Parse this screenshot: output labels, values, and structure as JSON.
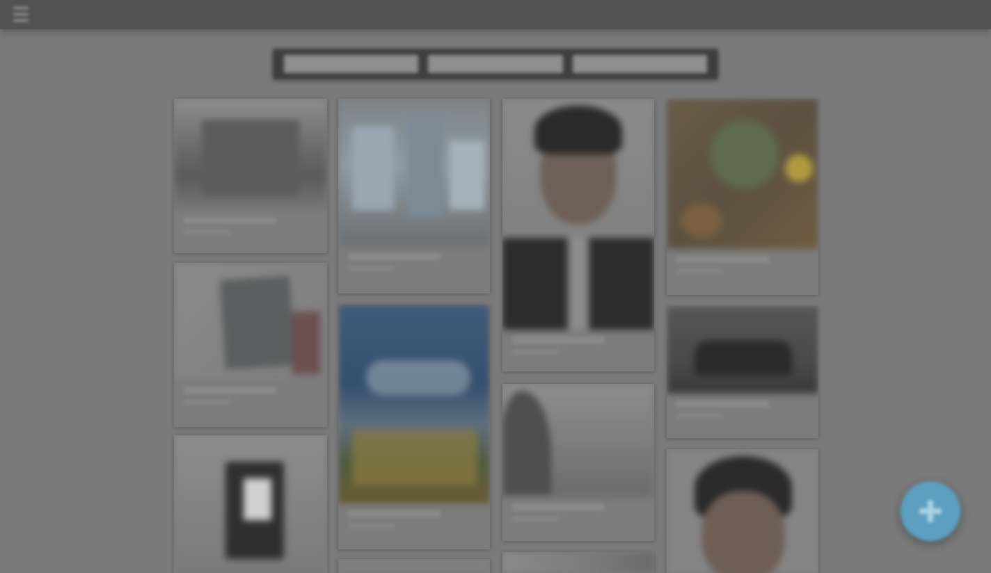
{
  "header": {
    "menu_icon": "hamburger-menu-icon"
  },
  "tabs": [
    {
      "label": ""
    },
    {
      "label": ""
    },
    {
      "label": ""
    }
  ],
  "cards": [
    {
      "name": "card-mountain-bw"
    },
    {
      "name": "card-city-buildings"
    },
    {
      "name": "card-portrait-suit"
    },
    {
      "name": "card-food-plate"
    },
    {
      "name": "card-tablet-hand"
    },
    {
      "name": "card-city-night"
    },
    {
      "name": "card-landscape-mist"
    },
    {
      "name": "card-car-dark"
    },
    {
      "name": "card-camera-bw"
    },
    {
      "name": "card-portrait-closeup"
    },
    {
      "name": "card-partial-bottom-2"
    },
    {
      "name": "card-partial-bottom-3"
    }
  ],
  "fab": {
    "icon": "plus-icon",
    "color": "#5d9fbf"
  },
  "colors": {
    "background": "#7a7a7a",
    "topbar": "#525252",
    "fab": "#5d9fbf"
  }
}
